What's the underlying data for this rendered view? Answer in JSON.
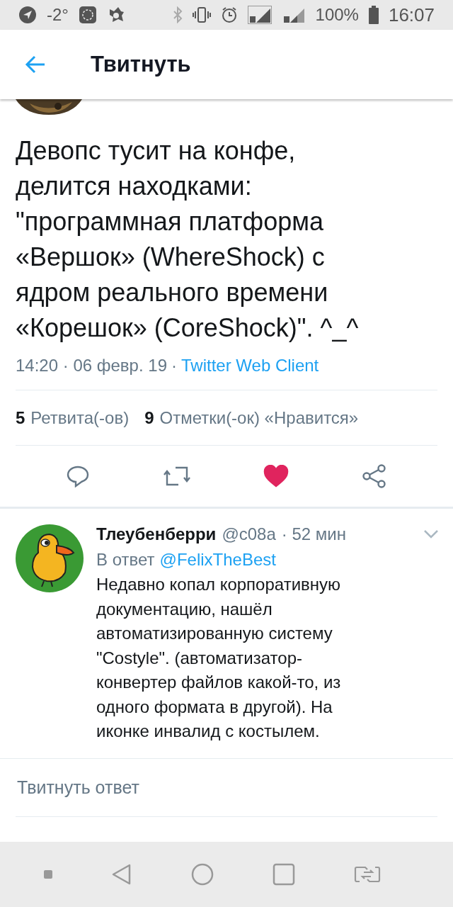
{
  "status_bar": {
    "temperature": "-2°",
    "battery": "100%",
    "time": "16:07"
  },
  "header": {
    "title": "Твитнуть"
  },
  "tweet": {
    "text": "Девопс тусит на конфе, делится находками: \"программная платформа «Вершок» (WhereShock) с ядром реального времени «Корешок» (CoreShock)\". ^_^",
    "time": "14:20 · 06 февр. 19",
    "separator": "·",
    "source": "Twitter Web Client",
    "retweets_count": "5",
    "retweets_label": "Ретвита(-ов)",
    "likes_count": "9",
    "likes_label": "Отметки(-ок) «Нравится»",
    "liked": true
  },
  "reply": {
    "name": "Тлеубенберри",
    "handle": "@c08a",
    "time": "· 52 мин",
    "in_reply_prefix": "В ответ",
    "in_reply_to": "@FelixTheBest",
    "text": "Недавно копал корпоративную документацию, нашёл автоматизированную систему \"Costyle\". (автоматизатор-конвертер файлов какой-то, из одного формата в другой). На иконке инвалид с костылем."
  },
  "compose": {
    "placeholder": "Твитнуть ответ"
  }
}
